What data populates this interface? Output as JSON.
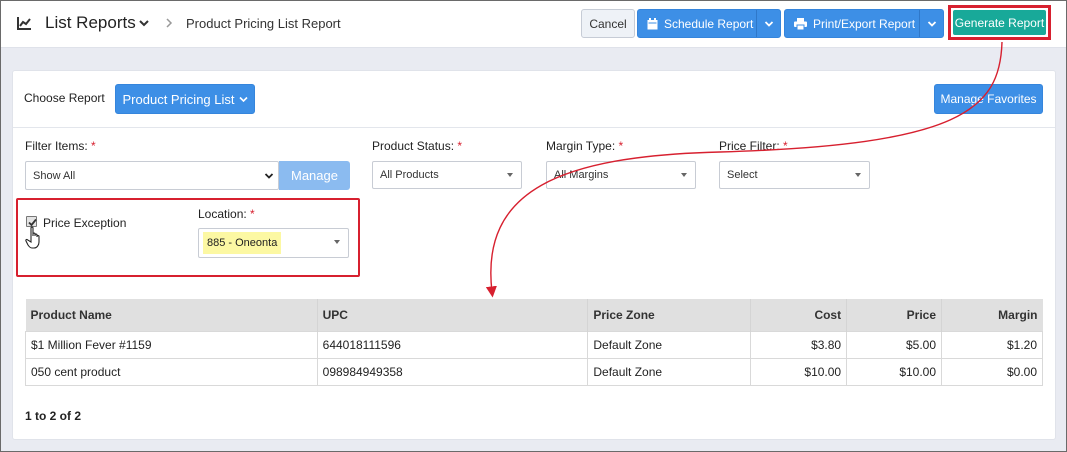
{
  "header": {
    "app_title": "List Reports",
    "breadcrumb": "Product Pricing List Report",
    "cancel_label": "Cancel",
    "schedule_label": "Schedule Report",
    "print_label": "Print/Export Report",
    "generate_label": "Generate Report"
  },
  "report": {
    "choose_label": "Choose Report",
    "selected_report": "Product Pricing List",
    "favorites_label": "Manage Favorites"
  },
  "filters": {
    "filter_items_label": "Filter Items:",
    "filter_items_value": "Show All",
    "manage_label": "Manage",
    "product_status_label": "Product Status:",
    "product_status_value": "All Products",
    "margin_type_label": "Margin Type:",
    "margin_type_value": "All Margins",
    "price_filter_label": "Price Filter:",
    "price_filter_value": "Select",
    "required_mark": "*",
    "price_exception_label": "Price Exception",
    "price_exception_checked": true,
    "location_label": "Location:",
    "location_value": "885 - Oneonta"
  },
  "table": {
    "columns": [
      "Product Name",
      "UPC",
      "Price Zone",
      "Cost",
      "Price",
      "Margin"
    ],
    "rows": [
      [
        "$1 Million Fever #1159",
        "644018111596",
        "Default Zone",
        "$3.80",
        "$5.00",
        "$1.20"
      ],
      [
        "050 cent product",
        "098984949358",
        "Default Zone",
        "$10.00",
        "$10.00",
        "$0.00"
      ]
    ]
  },
  "pagination": {
    "summary": "1 to 2 of 2"
  },
  "colors": {
    "primary": "#3d8fe6",
    "generate": "#18a999",
    "highlight": "#d7202f",
    "location_highlight": "#fcf8a3"
  }
}
